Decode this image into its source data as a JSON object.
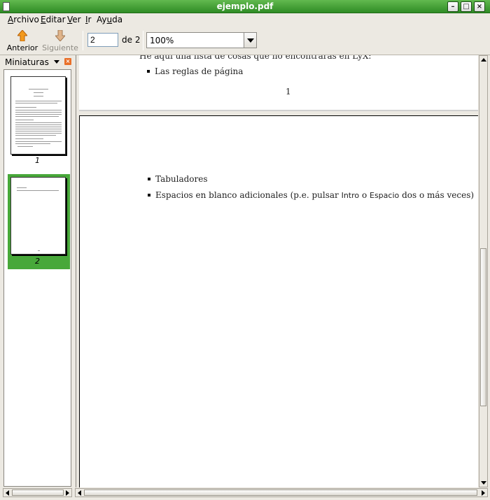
{
  "window": {
    "title": "ejemplo.pdf",
    "minimize": "–",
    "maximize": "□",
    "close": "×"
  },
  "menu": [
    {
      "label": "Archivo",
      "u": "A",
      "rest": "rchivo"
    },
    {
      "label": "Editar",
      "u": "E",
      "rest": "ditar"
    },
    {
      "label": "Ver",
      "u": "V",
      "rest": "er"
    },
    {
      "label": "Ir",
      "u": "I",
      "rest": "r"
    },
    {
      "label": "Ayuda",
      "pre": "Ay",
      "u": "u",
      "rest": "da"
    }
  ],
  "toolbar": {
    "prev_label": "Anterior",
    "next_label": "Siguiente",
    "page_value": "2",
    "page_total": "de 2",
    "zoom": "100%"
  },
  "sidebar": {
    "title": "Miniaturas",
    "thumbnails": [
      {
        "label": "1",
        "selected": false
      },
      {
        "label": "2",
        "selected": true
      }
    ]
  },
  "document": {
    "page1": {
      "cut_line": "He aquí una lista de cosas que no encontrarás en LyX:",
      "bullet": "Las reglas de página",
      "page_number": "1"
    },
    "page2": {
      "bullet1": "Tabuladores",
      "bullet2_pre": "Espacios en blanco adicionales (p.e. pulsar ",
      "bullet2_key1": "Intro",
      "bullet2_mid": " o ",
      "bullet2_key2": "Espacio",
      "bullet2_post": " dos o más veces)"
    }
  }
}
